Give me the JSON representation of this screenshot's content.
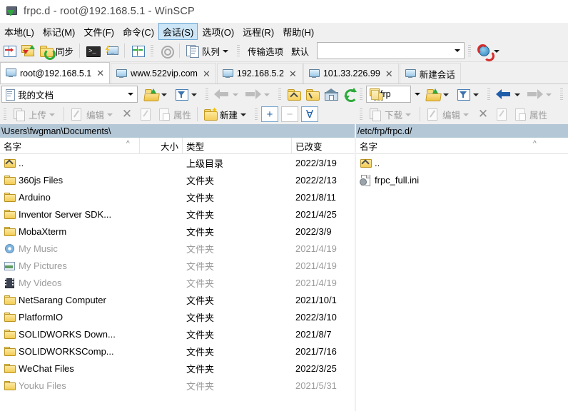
{
  "window": {
    "title": "frpc.d - root@192.168.5.1 - WinSCP",
    "app_icon": "winscp-icon"
  },
  "menu": {
    "items": [
      {
        "label": "本地(L)",
        "active": false
      },
      {
        "label": "标记(M)",
        "active": false
      },
      {
        "label": "文件(F)",
        "active": false
      },
      {
        "label": "命令(C)",
        "active": false
      },
      {
        "label": "会话(S)",
        "active": true
      },
      {
        "label": "选项(O)",
        "active": false
      },
      {
        "label": "远程(R)",
        "active": false
      },
      {
        "label": "帮助(H)",
        "active": false
      }
    ]
  },
  "toolbar": {
    "sync_label": "同步",
    "queue_label": "队列",
    "transfer_options_label": "传输选项",
    "transfer_preset": "默认",
    "transfer_combo_value": ""
  },
  "tabs": [
    {
      "label": "root@192.168.5.1",
      "active": true,
      "closable": true
    },
    {
      "label": "www.522vip.com",
      "active": false,
      "closable": true
    },
    {
      "label": "192.168.5.2",
      "active": false,
      "closable": true
    },
    {
      "label": "101.33.226.99",
      "active": false,
      "closable": true
    },
    {
      "label": "新建会话",
      "active": false,
      "closable": false
    }
  ],
  "left_panel": {
    "drive_label": "我的文档",
    "path": "\\Users\\fwgman\\Documents\\",
    "filebar": {
      "upload_label": "上传",
      "edit_label": "编辑",
      "properties_label": "属性",
      "new_label": "新建"
    },
    "columns": [
      {
        "label": "名字",
        "align": "left",
        "sorted": "asc"
      },
      {
        "label": "大小",
        "align": "right",
        "sorted": ""
      },
      {
        "label": "类型",
        "align": "left",
        "sorted": ""
      },
      {
        "label": "已改变",
        "align": "left",
        "sorted": ""
      }
    ],
    "rows": [
      {
        "icon": "up-folder-icon",
        "name": "..",
        "size": "",
        "type": "上级目录",
        "changed": "2022/3/19",
        "dim": false
      },
      {
        "icon": "folder-icon",
        "name": "360js Files",
        "size": "",
        "type": "文件夹",
        "changed": "2022/2/13",
        "dim": false
      },
      {
        "icon": "folder-icon",
        "name": "Arduino",
        "size": "",
        "type": "文件夹",
        "changed": "2021/8/11",
        "dim": false
      },
      {
        "icon": "folder-icon",
        "name": "Inventor Server SDK...",
        "size": "",
        "type": "文件夹",
        "changed": "2021/4/25",
        "dim": false
      },
      {
        "icon": "folder-icon",
        "name": "MobaXterm",
        "size": "",
        "type": "文件夹",
        "changed": "2022/3/9",
        "dim": false
      },
      {
        "icon": "music-folder-icon",
        "name": "My Music",
        "size": "",
        "type": "文件夹",
        "changed": "2021/4/19",
        "dim": true
      },
      {
        "icon": "pictures-folder-icon",
        "name": "My Pictures",
        "size": "",
        "type": "文件夹",
        "changed": "2021/4/19",
        "dim": true
      },
      {
        "icon": "videos-folder-icon",
        "name": "My Videos",
        "size": "",
        "type": "文件夹",
        "changed": "2021/4/19",
        "dim": true
      },
      {
        "icon": "folder-icon",
        "name": "NetSarang Computer",
        "size": "",
        "type": "文件夹",
        "changed": "2021/10/1",
        "dim": false
      },
      {
        "icon": "folder-icon",
        "name": "PlatformIO",
        "size": "",
        "type": "文件夹",
        "changed": "2022/3/10",
        "dim": false
      },
      {
        "icon": "folder-icon",
        "name": "SOLIDWORKS Down...",
        "size": "",
        "type": "文件夹",
        "changed": "2021/8/7",
        "dim": false
      },
      {
        "icon": "folder-icon",
        "name": "SOLIDWORKSComp...",
        "size": "",
        "type": "文件夹",
        "changed": "2021/7/16",
        "dim": false
      },
      {
        "icon": "folder-icon",
        "name": "WeChat Files",
        "size": "",
        "type": "文件夹",
        "changed": "2022/3/25",
        "dim": false
      },
      {
        "icon": "folder-icon",
        "name": "Youku Files",
        "size": "",
        "type": "文件夹",
        "changed": "2021/5/31",
        "dim": false
      }
    ]
  },
  "right_panel": {
    "drive_label": "frp",
    "path": "/etc/frp/frpc.d/",
    "filebar": {
      "download_label": "下载",
      "edit_label": "编辑",
      "properties_label": "属性"
    },
    "columns": [
      {
        "label": "名字",
        "align": "left",
        "sorted": "asc"
      }
    ],
    "rows": [
      {
        "icon": "up-folder-icon",
        "name": "..",
        "dim": false
      },
      {
        "icon": "ini-file-icon",
        "name": "frpc_full.ini",
        "dim": false
      }
    ]
  },
  "colors": {
    "accent": "#1f5fa9",
    "path_bg": "#b4c7d7",
    "menu_active_bg": "#cde6f7",
    "folder": "#f3cc57",
    "dim_text": "#9c9c9c"
  }
}
